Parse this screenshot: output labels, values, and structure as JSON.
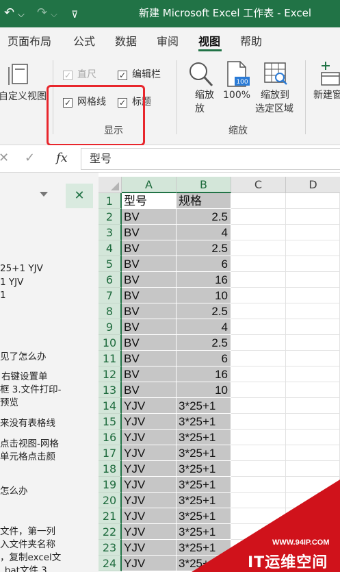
{
  "titlebar": {
    "title": "新建 Microsoft Excel 工作表 - Excel",
    "undo_icon": "undo-icon",
    "redo_icon": "redo-icon",
    "customize_icon": "customize-qat-icon",
    "accent": "#217346"
  },
  "tabs": [
    {
      "label": "页面布局"
    },
    {
      "label": "公式"
    },
    {
      "label": "数据"
    },
    {
      "label": "审阅"
    },
    {
      "label": "视图",
      "active": true
    },
    {
      "label": "帮助"
    }
  ],
  "ribbon": {
    "custom_view_label": "自定义视图",
    "ruler_label": "直尺",
    "formula_bar_label": "编辑栏",
    "gridlines_label": "网格线",
    "headings_label": "标题",
    "show_group_label": "显示",
    "zoom_label": "缩放",
    "zoom_label_line2": "放",
    "zoom100_label": "100%",
    "zoom_selection_line1": "缩放到",
    "zoom_selection_line2": "选定区域",
    "zoom_group_label": "缩放",
    "new_window_label": "新建窗",
    "ruler_checked": true,
    "formula_bar_checked": true,
    "gridlines_checked": true,
    "headings_checked": true,
    "highlight_color": "#e8262c"
  },
  "formula_bar": {
    "fx": "fx",
    "value": "型号"
  },
  "left_pane": {
    "lines": [
      "25+1 YJV",
      "1 YJV",
      "1",
      "见了怎么办",
      "右键设置单",
      "框 3.文件打印-",
      "预览",
      "来没有表格线",
      "点击视图-网格",
      "单元格点击颜",
      "怎么办",
      "文件，第一列",
      "入文件夹名称",
      "，复制excel文",
      "_bat文件 3"
    ]
  },
  "grid": {
    "columns": [
      "A",
      "B",
      "C",
      "D"
    ],
    "rows": [
      {
        "n": "1",
        "a": "型号",
        "b": "规格"
      },
      {
        "n": "2",
        "a": "BV",
        "b": "2.5"
      },
      {
        "n": "3",
        "a": "BV",
        "b": "4"
      },
      {
        "n": "4",
        "a": "BV",
        "b": "2.5"
      },
      {
        "n": "5",
        "a": "BV",
        "b": "6"
      },
      {
        "n": "6",
        "a": "BV",
        "b": "16"
      },
      {
        "n": "7",
        "a": "BV",
        "b": "10"
      },
      {
        "n": "8",
        "a": "BV",
        "b": "2.5"
      },
      {
        "n": "9",
        "a": "BV",
        "b": "4"
      },
      {
        "n": "10",
        "a": "BV",
        "b": "2.5"
      },
      {
        "n": "11",
        "a": "BV",
        "b": "6"
      },
      {
        "n": "12",
        "a": "BV",
        "b": "16"
      },
      {
        "n": "13",
        "a": "BV",
        "b": "10"
      },
      {
        "n": "14",
        "a": "YJV",
        "b": "3*25+1"
      },
      {
        "n": "15",
        "a": "YJV",
        "b": "3*25+1"
      },
      {
        "n": "16",
        "a": "YJV",
        "b": "3*25+1"
      },
      {
        "n": "17",
        "a": "YJV",
        "b": "3*25+1"
      },
      {
        "n": "18",
        "a": "YJV",
        "b": "3*25+1"
      },
      {
        "n": "19",
        "a": "YJV",
        "b": "3*25+1"
      },
      {
        "n": "20",
        "a": "YJV",
        "b": "3*25+1"
      },
      {
        "n": "21",
        "a": "YJV",
        "b": "3*25+1"
      },
      {
        "n": "22",
        "a": "YJV",
        "b": "3*25+1"
      },
      {
        "n": "23",
        "a": "YJV",
        "b": "3*25+1"
      },
      {
        "n": "24",
        "a": "YJV",
        "b": "3*25+1"
      }
    ]
  },
  "watermark": {
    "url": "WWW.94IP.COM",
    "text": "IT运维空间",
    "color": "#d0121b"
  }
}
